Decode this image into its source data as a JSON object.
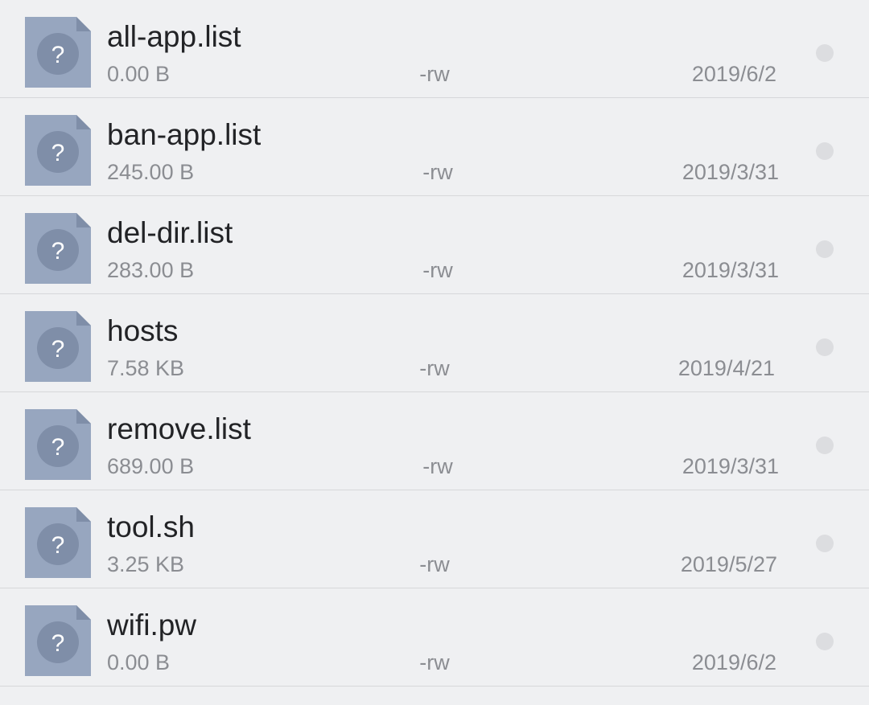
{
  "colors": {
    "background": "#eff0f2",
    "icon_fill": "#97a6bf",
    "icon_badge": "#7f8ea8",
    "text_primary": "#222326",
    "text_secondary": "#8b8d92"
  },
  "files": [
    {
      "name": "all-app.list",
      "size": "0.00 B",
      "permissions": "-rw",
      "date": "2019/6/2",
      "icon": "unknown-file-icon",
      "icon_glyph": "?"
    },
    {
      "name": "ban-app.list",
      "size": "245.00 B",
      "permissions": "-rw",
      "date": "2019/3/31",
      "icon": "unknown-file-icon",
      "icon_glyph": "?"
    },
    {
      "name": "del-dir.list",
      "size": "283.00 B",
      "permissions": "-rw",
      "date": "2019/3/31",
      "icon": "unknown-file-icon",
      "icon_glyph": "?"
    },
    {
      "name": "hosts",
      "size": "7.58 KB",
      "permissions": "-rw",
      "date": "2019/4/21",
      "icon": "unknown-file-icon",
      "icon_glyph": "?"
    },
    {
      "name": "remove.list",
      "size": "689.00 B",
      "permissions": "-rw",
      "date": "2019/3/31",
      "icon": "unknown-file-icon",
      "icon_glyph": "?"
    },
    {
      "name": "tool.sh",
      "size": "3.25 KB",
      "permissions": "-rw",
      "date": "2019/5/27",
      "icon": "unknown-file-icon",
      "icon_glyph": "?"
    },
    {
      "name": "wifi.pw",
      "size": "0.00 B",
      "permissions": "-rw",
      "date": "2019/6/2",
      "icon": "unknown-file-icon",
      "icon_glyph": "?"
    }
  ]
}
